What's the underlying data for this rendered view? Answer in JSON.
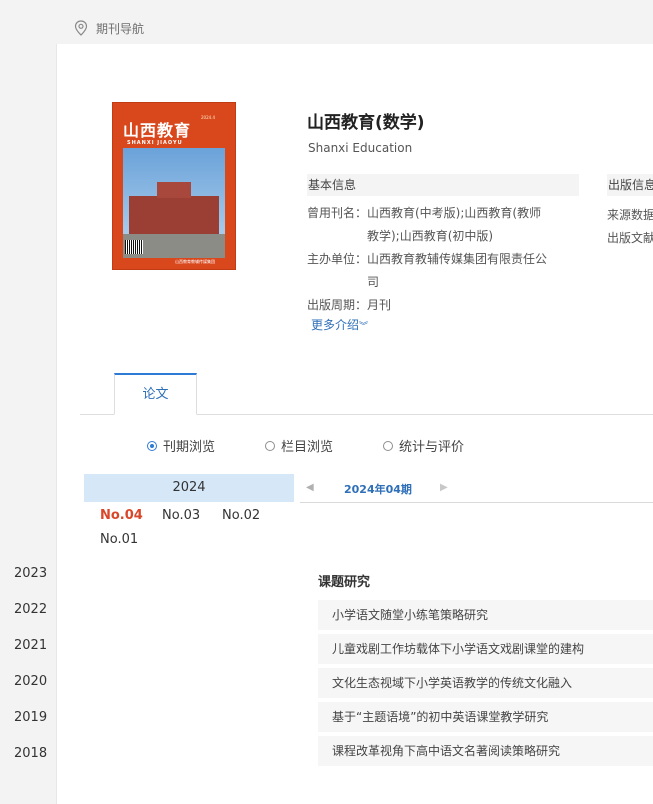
{
  "breadcrumb": {
    "icon": "location-pin-icon",
    "text": "期刊导航"
  },
  "journal": {
    "title": "山西教育(数学)",
    "subtitle": "Shanxi Education",
    "cover": {
      "logo": "山西教育",
      "logo_sub": "SHANXI JIAOYU",
      "issue_text": "2024.4",
      "publisher_text": "山西教育教辅传媒集团"
    }
  },
  "basic_info": {
    "heading": "基本信息",
    "former_name_label": "曾用刊名：",
    "former_name_value": "山西教育(中考版);山西教育(教师教学);山西教育(初中版)",
    "sponsor_label": "主办单位：",
    "sponsor_value": "山西教育教辅传媒集团有限责任公司",
    "period_label": "出版周期：",
    "period_value": "月刊",
    "more_link": "更多介绍",
    "more_icon": "double-chevron-down-icon"
  },
  "publish_info": {
    "heading": "出版信息",
    "row1": "来源数据",
    "row2": "出版文献"
  },
  "tabs": [
    {
      "label": "论文",
      "active": true
    }
  ],
  "browse_options": [
    {
      "label": "刊期浏览",
      "selected": true
    },
    {
      "label": "栏目浏览",
      "selected": false
    },
    {
      "label": "统计与评价",
      "selected": false
    }
  ],
  "years": {
    "current": "2024",
    "issues": [
      "No.04",
      "No.03",
      "No.02",
      "No.01"
    ],
    "active_issue": "No.04",
    "others": [
      "2023",
      "2022",
      "2021",
      "2020",
      "2019",
      "2018"
    ]
  },
  "issue_bar": {
    "prev_icon": "triangle-left-icon",
    "next_icon": "triangle-right-icon",
    "current": "2024年04期"
  },
  "column": {
    "title": "课题研究",
    "articles": [
      "小学语文随堂小练笔策略研究",
      "儿童戏剧工作坊载体下小学语文戏剧课堂的建构",
      "文化生态视域下小学英语教学的传统文化融入",
      "基于“主题语境”的初中英语课堂教学研究",
      "课程改革视角下高中语文名著阅读策略研究"
    ]
  },
  "colors": {
    "accent": "#2e7bd6",
    "active_issue": "#d9472a",
    "year_highlight": "#d6e7f7",
    "link": "#2e6fb8"
  }
}
